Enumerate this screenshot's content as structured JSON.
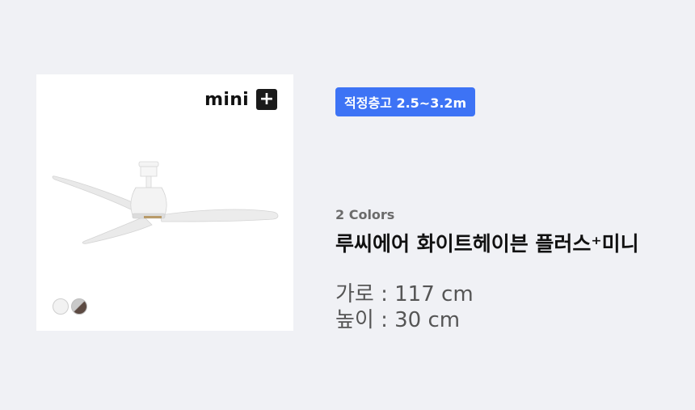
{
  "product": {
    "brand_mark": "mini",
    "brand_plus": "+",
    "badge": "적정층고 2.5~3.2m",
    "colors_label": "2 Colors",
    "name": "루씨에어 화이트헤이븐 플러스⁺미니",
    "specs": {
      "width": "가로 : 117 cm",
      "height": "높이 : 30 cm"
    },
    "swatches": [
      {
        "name": "white",
        "color": "#f2f2f2"
      },
      {
        "name": "wood",
        "color": "#5c4a42"
      }
    ]
  },
  "colors": {
    "background": "#f0f1f5",
    "badge_blue": "#3d73f5"
  }
}
